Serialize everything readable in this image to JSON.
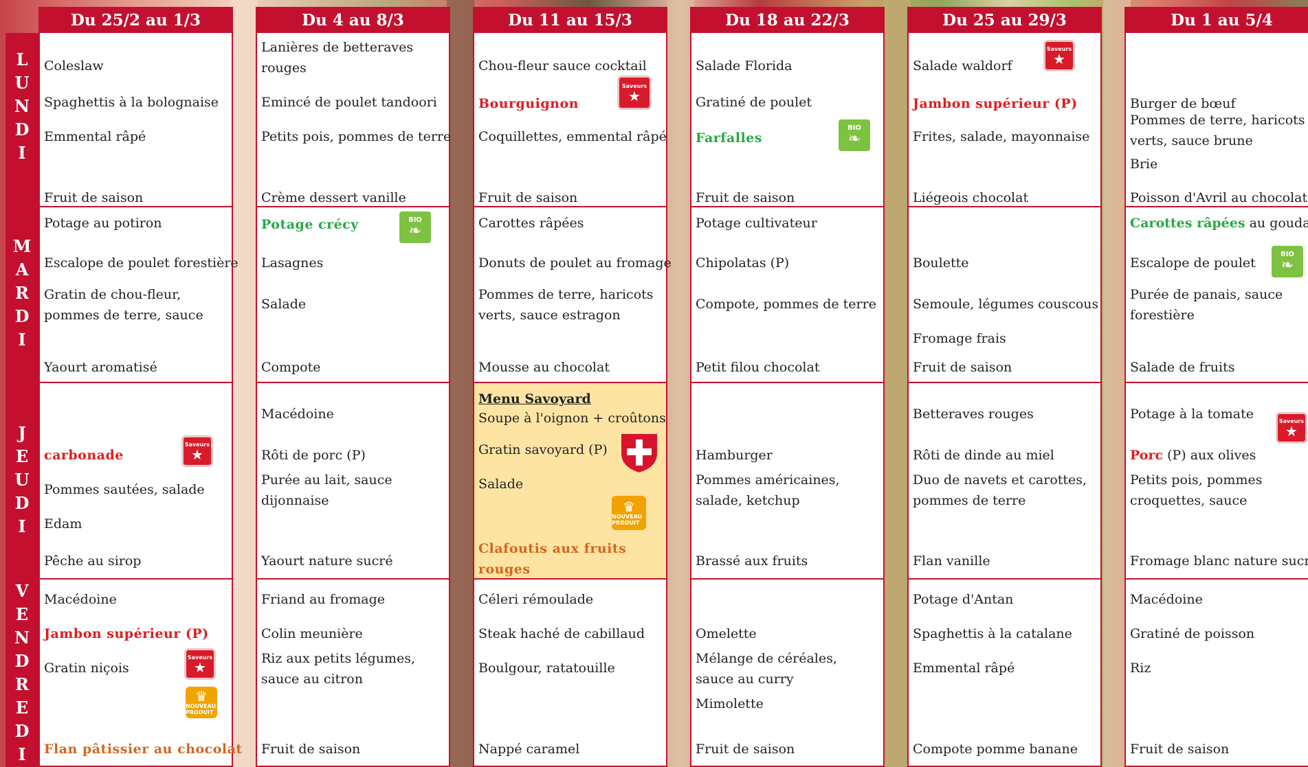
{
  "day_labels": {
    "lundi": [
      "L",
      "U",
      "N",
      "D",
      "I"
    ],
    "mardi": [
      "M",
      "A",
      "R",
      "D",
      "I"
    ],
    "jeudi": [
      "J",
      "E",
      "U",
      "D",
      "I"
    ],
    "vendredi": [
      "V",
      "E",
      "N",
      "D",
      "R",
      "E",
      "D",
      "I"
    ]
  },
  "logo_text": {
    "saveurs": "Saveurs",
    "bio": "BIO",
    "nouveau": "NOUVEAU PRODUIT"
  },
  "colors": {
    "header_red": "#c4102f",
    "highlight_red": "#e01b1e",
    "bio_green": "#29a846",
    "dessert_orange": "#d4661f",
    "savoy_bg": "#fde4a3"
  },
  "weeks": [
    {
      "header": "Du 25/2 au 1/3",
      "lundi": [
        "Coleslaw",
        "Spaghettis à la bolognaise",
        "Emmental râpé",
        "Fruit de saison"
      ],
      "mardi": [
        "Potage au potiron",
        "Escalope de poulet forestière",
        "Gratin de chou-fleur, pommes de terre, sauce",
        "Yaourt aromatisé"
      ],
      "jeudi": [
        "carbonade",
        "Pommes sautées, salade",
        "Edam",
        "Pêche au sirop"
      ],
      "vendredi": [
        "Macédoine",
        "Jambon supérieur (P)",
        "Gratin niçois",
        "Flan pâtissier au chocolat"
      ]
    },
    {
      "header": "Du 4 au 8/3",
      "lundi": [
        "Lanières de betteraves rouges",
        "Emincé de poulet tandoori",
        "Petits pois, pommes de terre",
        "Crème dessert vanille"
      ],
      "mardi": [
        "Potage crécy",
        "Lasagnes",
        "Salade",
        "Compote"
      ],
      "jeudi": [
        "Macédoine",
        "Rôti de porc (P)",
        "Purée au lait, sauce dijonnaise",
        "Yaourt nature sucré"
      ],
      "vendredi": [
        "Friand au fromage",
        "Colin meunière",
        "Riz aux petits légumes, sauce au citron",
        "Fruit de saison"
      ]
    },
    {
      "header": "Du 11 au 15/3",
      "lundi": [
        "Chou-fleur sauce cocktail",
        "Bourguignon",
        "Coquillettes, emmental râpé",
        "Fruit de saison"
      ],
      "mardi": [
        "Carottes râpées",
        "Donuts de poulet au fromage",
        "Pommes de terre, haricots verts, sauce estragon",
        "Mousse au chocolat"
      ],
      "jeudi": [
        "Menu Savoyard",
        "Soupe à l'oignon + croûtons",
        "Gratin savoyard (P)",
        "Salade",
        "Clafoutis aux fruits rouges"
      ],
      "vendredi": [
        "Céleri rémoulade",
        "Steak haché de cabillaud",
        "Boulgour, ratatouille",
        "Nappé caramel"
      ]
    },
    {
      "header": "Du 18 au 22/3",
      "lundi": [
        "Salade Florida",
        "Gratiné de poulet",
        "Farfalles",
        "Fruit de saison"
      ],
      "mardi": [
        "Potage cultivateur",
        "Chipolatas (P)",
        "Compote, pommes de terre",
        "Petit filou chocolat"
      ],
      "jeudi": [
        "Hamburger",
        "Pommes américaines, salade, ketchup",
        "Brassé aux fruits"
      ],
      "vendredi": [
        "Omelette",
        "Mélange de céréales, sauce au curry",
        "Mimolette",
        "Fruit de saison"
      ]
    },
    {
      "header": "Du 25 au 29/3",
      "lundi": [
        "Salade waldorf",
        "Jambon supérieur (P)",
        "Frites, salade, mayonnaise",
        "Liégeois chocolat"
      ],
      "mardi": [
        "Boulette",
        "Semoule, légumes couscous",
        "Fromage frais",
        "Fruit de saison"
      ],
      "jeudi": [
        "Betteraves rouges",
        "Rôti de dinde au miel",
        "Duo de navets et carottes, pommes de terre",
        "Flan vanille"
      ],
      "vendredi": [
        "Potage d'Antan",
        "Spaghettis à la catalane",
        "Emmental râpé",
        "Compote pomme banane"
      ]
    },
    {
      "header": "Du 1 au 5/4",
      "lundi": [
        "Burger de bœuf",
        "Pommes de terre, haricots verts, sauce brune",
        "Brie",
        "Poisson d'Avril au chocolat"
      ],
      "mardi": [
        "Carottes râpées",
        " au gouda",
        "Escalope de poulet",
        "Purée de panais, sauce forestière",
        "Salade de fruits"
      ],
      "jeudi": [
        "Potage à la tomate",
        "Porc",
        " (P) aux olives",
        "Petits pois, pommes croquettes, sauce",
        "Fromage blanc nature sucré"
      ],
      "vendredi": [
        "Macédoine",
        "Gratiné de poisson",
        "Riz",
        "Fruit de saison"
      ]
    }
  ]
}
